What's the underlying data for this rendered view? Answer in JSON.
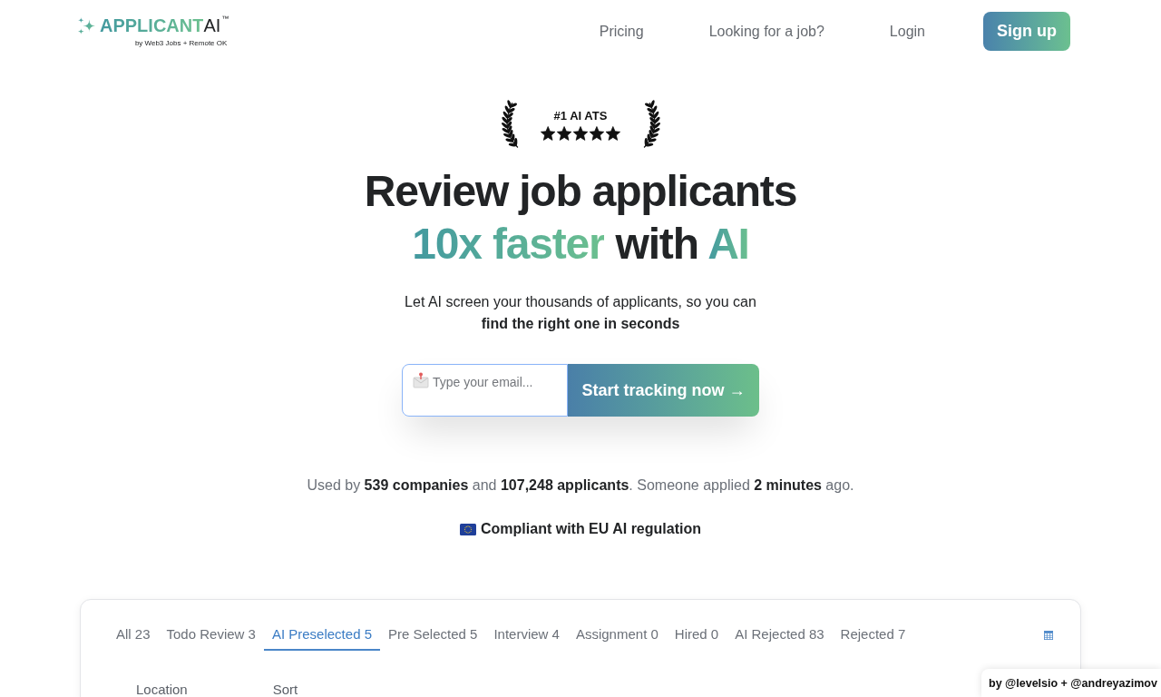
{
  "header": {
    "logo": {
      "wordmark": "APPLICANT",
      "wordmark_suffix": "AI",
      "trademark": "™",
      "byline": "by Web3 Jobs + Remote OK"
    },
    "nav_links": [
      "Pricing",
      "Looking for a job?",
      "Login"
    ],
    "signup_button": "Sign up"
  },
  "hero": {
    "award": {
      "title": "#1 AI ATS",
      "stars": 5
    },
    "headline": [
      [
        {
          "text": "Review job applicants",
          "kind": "plain"
        }
      ],
      [
        {
          "text": "10x faster",
          "kind": "gradient"
        },
        {
          "text": "with",
          "kind": "plain"
        },
        {
          "text": "AI",
          "kind": "gradient"
        }
      ]
    ],
    "subtitle": "Let AI screen your thousands of applicants, so you can **find the right one in seconds**",
    "signup_form": {
      "placeholder": "Type your email...",
      "button": "Start tracking now →"
    },
    "stats": "Used by **539 companies** and **107,248 applicants**. Someone applied **2 minutes** ago.",
    "compliance": "Compliant with EU AI regulation"
  },
  "applicants_panel": {
    "tabs": [
      {
        "label": "All 23",
        "selected": false
      },
      {
        "label": "Todo Review 3",
        "selected": false
      },
      {
        "label": "AI Preselected 5",
        "selected": true
      },
      {
        "label": "Pre Selected 5",
        "selected": false
      },
      {
        "label": "Interview 4",
        "selected": false
      },
      {
        "label": "Assignment 0",
        "selected": false
      },
      {
        "label": "Hired 0",
        "selected": false
      },
      {
        "label": "AI Rejected 83",
        "selected": false
      },
      {
        "label": "Rejected 7",
        "selected": false
      }
    ],
    "filters": [
      "Location",
      "Sort"
    ]
  },
  "credit_badge": "by @levelsio + @andreyazimov"
}
